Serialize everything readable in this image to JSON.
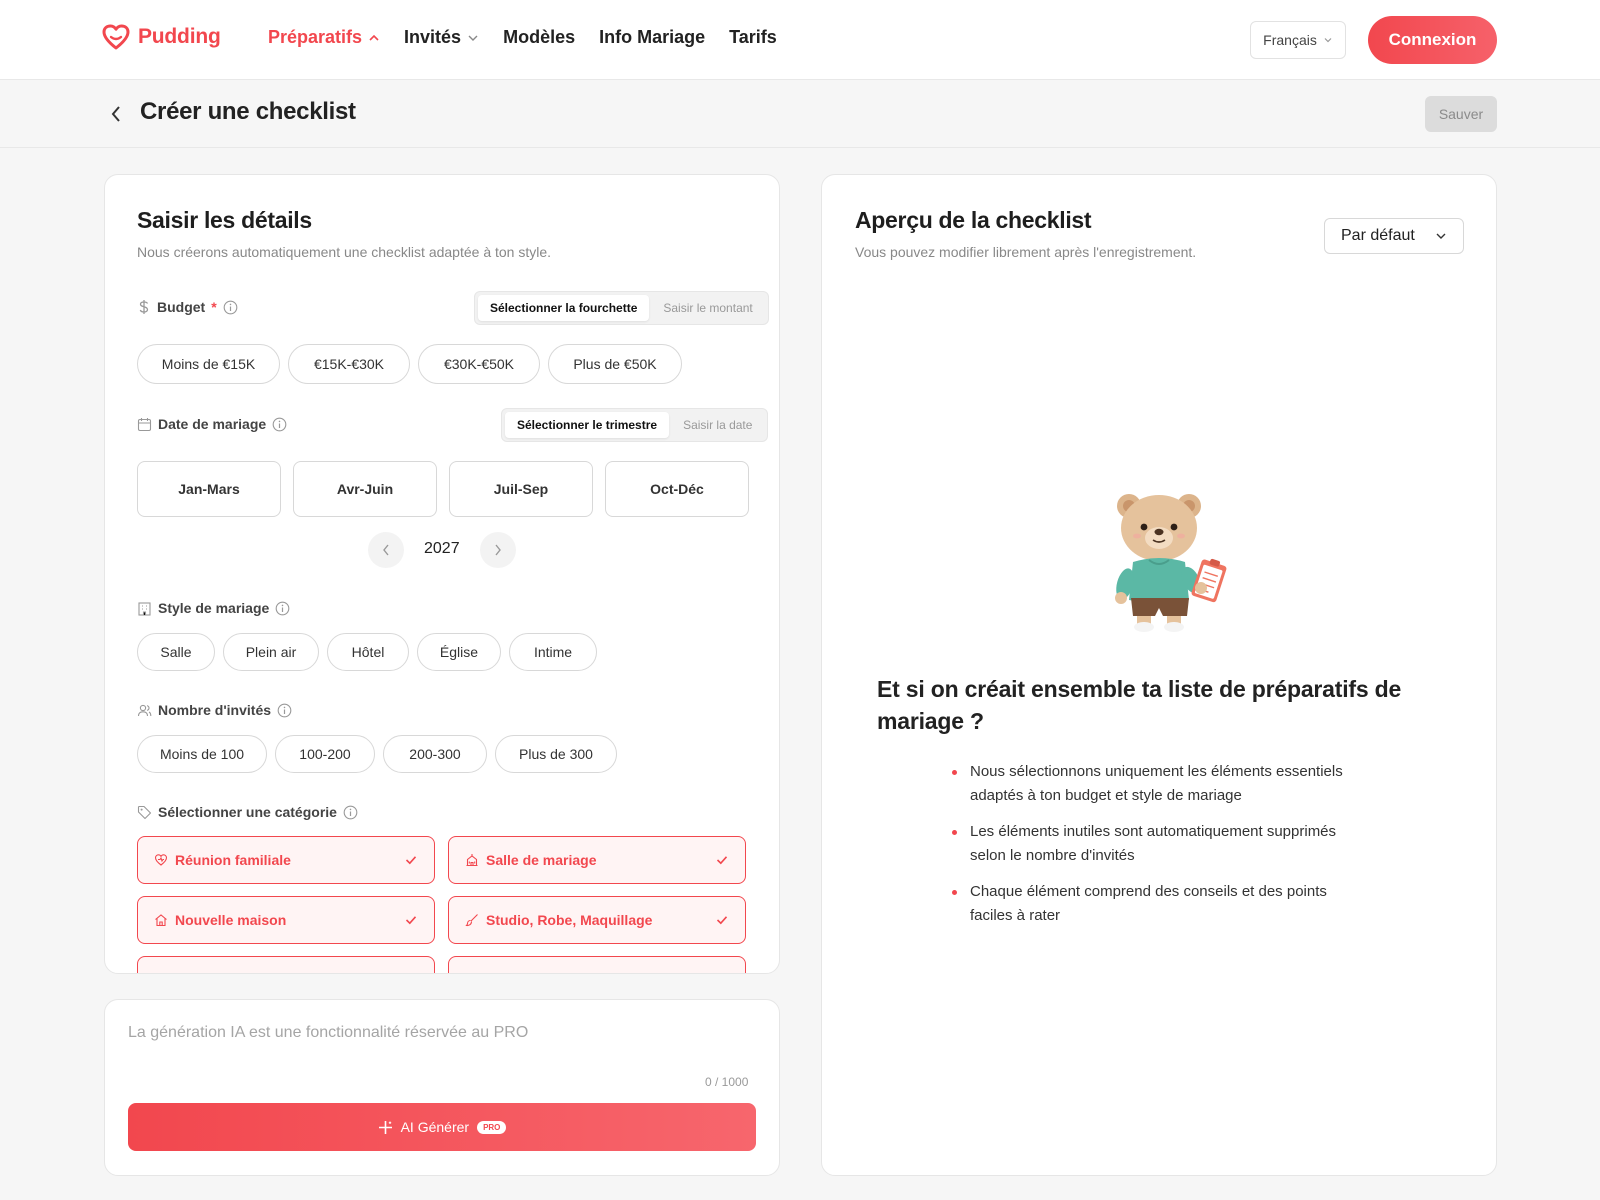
{
  "brand": {
    "name": "Pudding",
    "accent": "#f2474e"
  },
  "nav": {
    "items": [
      {
        "label": "Préparatifs",
        "active": true,
        "icon": "chevron-up-icon"
      },
      {
        "label": "Invités",
        "icon": "chevron-down-icon"
      },
      {
        "label": "Modèles"
      },
      {
        "label": "Info Mariage"
      },
      {
        "label": "Tarifs"
      }
    ],
    "language": "Français",
    "login": "Connexion"
  },
  "header": {
    "title": "Créer une checklist",
    "save": "Sauver"
  },
  "details": {
    "title": "Saisir les détails",
    "subtitle": "Nous créerons automatiquement une checklist adaptée à ton style.",
    "budget": {
      "label": "Budget",
      "required": "*",
      "mode_range": "Sélectionner la fourchette",
      "mode_amount": "Saisir le montant",
      "options": [
        "Moins de €15K",
        "€15K-€30K",
        "€30K-€50K",
        "Plus de €50K"
      ]
    },
    "date": {
      "label": "Date de mariage",
      "mode_quarter": "Sélectionner le trimestre",
      "mode_date": "Saisir la date",
      "quarters": [
        "Jan-Mars",
        "Avr-Juin",
        "Juil-Sep",
        "Oct-Déc"
      ],
      "year": "2027"
    },
    "style": {
      "label": "Style de mariage",
      "options": [
        "Salle",
        "Plein air",
        "Hôtel",
        "Église",
        "Intime"
      ]
    },
    "guests": {
      "label": "Nombre d'invités",
      "options": [
        "Moins de 100",
        "100-200",
        "200-300",
        "Plus de 300"
      ]
    },
    "category": {
      "label": "Sélectionner une catégorie",
      "items": [
        {
          "label": "Réunion familiale",
          "icon": "heart-icon",
          "selected": true
        },
        {
          "label": "Salle de mariage",
          "icon": "venue-icon",
          "selected": true
        },
        {
          "label": "Nouvelle maison",
          "icon": "home-icon",
          "selected": true
        },
        {
          "label": "Studio, Robe, Maquillage",
          "icon": "brush-icon",
          "selected": true
        }
      ]
    }
  },
  "ai": {
    "placeholder": "La génération IA est une fonctionnalité réservée au PRO",
    "counter": "0 / 1000",
    "button": "AI Générer",
    "badge": "PRO"
  },
  "preview": {
    "title": "Aperçu de la checklist",
    "subtitle": "Vous pouvez modifier librement après l'enregistrement.",
    "sort": "Par défaut",
    "promo_title": "Et si on créait ensemble ta liste de préparatifs de mariage ?",
    "bullets": [
      "Nous sélectionnons uniquement les éléments essentiels adaptés à ton budget et style de mariage",
      "Les éléments inutiles sont automatiquement supprimés selon le nombre d'invités",
      "Chaque élément comprend des conseils et des points faciles à rater"
    ]
  }
}
